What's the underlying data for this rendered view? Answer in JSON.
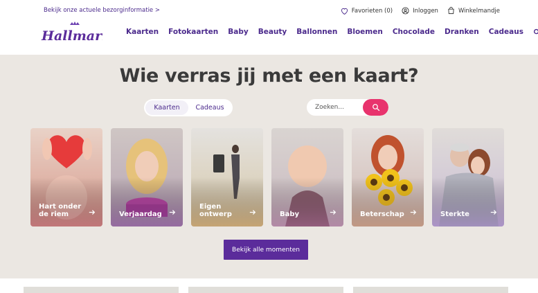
{
  "header": {
    "delivery_info": "Bekijk onze actuele bezorginformatie >",
    "favorites": "Favorieten (0)",
    "login": "Inloggen",
    "cart": "Winkelmandje",
    "logo_text": "Hallmark"
  },
  "nav": {
    "items": [
      {
        "label": "Kaarten"
      },
      {
        "label": "Fotokaarten"
      },
      {
        "label": "Baby"
      },
      {
        "label": "Beauty"
      },
      {
        "label": "Ballonnen"
      },
      {
        "label": "Bloemen"
      },
      {
        "label": "Chocolade"
      },
      {
        "label": "Dranken"
      },
      {
        "label": "Cadeaus"
      }
    ]
  },
  "hero": {
    "title": "Wie verras jij met een kaart?",
    "toggle": {
      "option1": "Kaarten",
      "option2": "Cadeaus"
    },
    "search": {
      "placeholder": "Zoeken..."
    },
    "button": "Bekijk alle momenten"
  },
  "cards": [
    {
      "label": "Hart onder de riem"
    },
    {
      "label": "Verjaardag"
    },
    {
      "label": "Eigen ontwerp"
    },
    {
      "label": "Baby"
    },
    {
      "label": "Beterschap"
    },
    {
      "label": "Sterkte"
    }
  ],
  "colors": {
    "brand_purple": "#5b2c9b",
    "accent_pink": "#e8336d",
    "hero_bg": "#ebe7e2"
  }
}
